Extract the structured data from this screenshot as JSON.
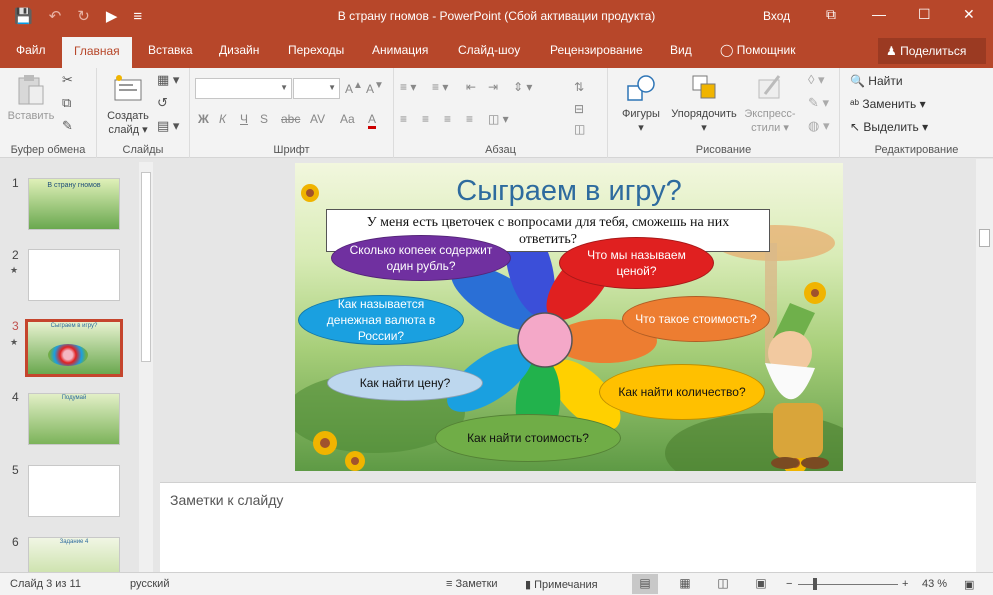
{
  "titlebar": {
    "title": "В страну гномов  -  PowerPoint (Сбой активации продукта)",
    "login": "Вход",
    "restore": "⧉",
    "minimize": "—",
    "maximize": "☐",
    "close": "✕"
  },
  "tabs": [
    "Файл",
    "Главная",
    "Вставка",
    "Дизайн",
    "Переходы",
    "Анимация",
    "Слайд-шоу",
    "Рецензирование",
    "Вид",
    "Помощник"
  ],
  "share_label": "Поделиться",
  "ribbon": {
    "clipboard": {
      "paste": "Вставить",
      "group": "Буфер обмена"
    },
    "slides": {
      "create_line1": "Создать",
      "create_line2": "слайд",
      "group": "Слайды"
    },
    "font": {
      "group": "Шрифт",
      "bold": "Ж",
      "italic": "К",
      "underline": "Ч",
      "strike": "S",
      "shadow": "abc",
      "spacing": "AV",
      "case": "Aa",
      "color": "A"
    },
    "paragraph": {
      "group": "Абзац"
    },
    "drawing": {
      "shapes": "Фигуры",
      "arrange": "Упорядочить",
      "styles_line1": "Экспресс-",
      "styles_line2": "стили",
      "group": "Рисование"
    },
    "editing": {
      "find": "Найти",
      "replace": "Заменить",
      "select": "Выделить",
      "group": "Редактирование"
    }
  },
  "thumbnails": [
    {
      "num": "1",
      "star": "",
      "title": "В страну гномов"
    },
    {
      "num": "2",
      "star": "★",
      "title": ""
    },
    {
      "num": "3",
      "star": "★",
      "title": "Сыграем в игру?"
    },
    {
      "num": "4",
      "star": "",
      "title": "Подумай"
    },
    {
      "num": "5",
      "star": "",
      "title": ""
    },
    {
      "num": "6",
      "star": "",
      "title": "Задание 4"
    }
  ],
  "slide": {
    "title": "Сыграем в игру?",
    "textbox": "У меня есть цветочек с вопросами для тебя, сможешь на них ответить?",
    "bubbles": {
      "kopeck": "Сколько копеек содержит один рубль?",
      "price_name": "Что мы называем ценой?",
      "currency": "Как называется денежная валюта в России?",
      "cost_what": "Что такое стоимость?",
      "find_price": "Как найти цену?",
      "find_qty": "Как найти количество?",
      "find_cost": "Как найти стоимость?"
    }
  },
  "notes_placeholder": "Заметки к слайду",
  "status": {
    "slide_info": "Слайд 3 из 11",
    "language": "русский",
    "notes": "Заметки",
    "comments": "Примечания",
    "zoom_minus": "−",
    "zoom_plus": "+",
    "zoom": "43 %"
  },
  "colors": {
    "accent": "#b7472a",
    "bubble_purple": "#7030a0",
    "bubble_red": "#e02020",
    "bubble_blue": "#1aa0e0",
    "bubble_orange": "#ed7d31",
    "bubble_lightblue": "#bdd7ee",
    "bubble_yellow": "#ffc000",
    "bubble_green": "#70ad47"
  }
}
